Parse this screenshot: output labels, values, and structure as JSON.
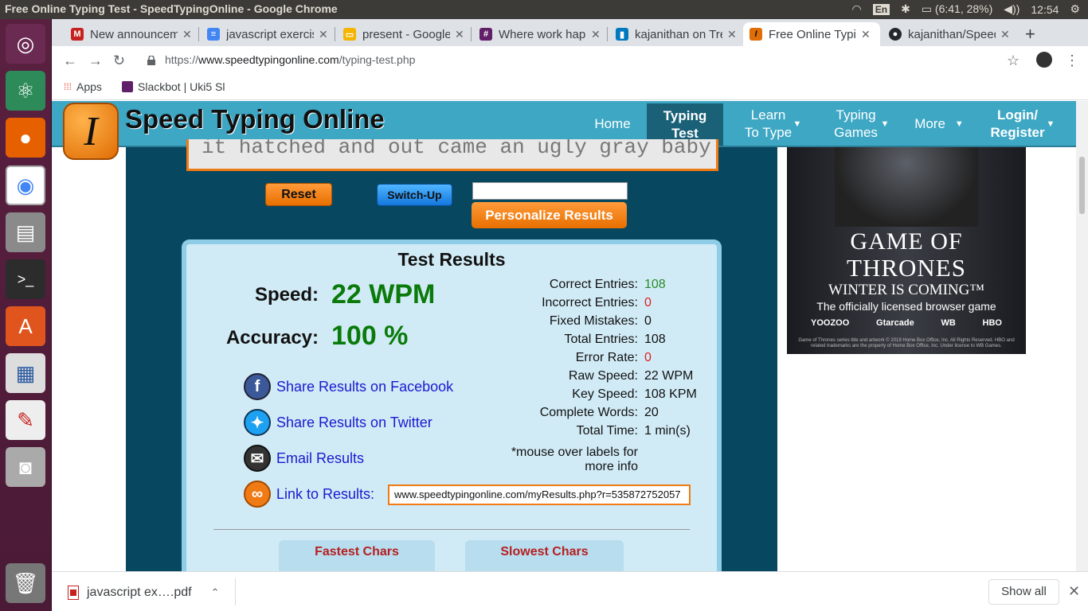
{
  "os": {
    "window_title": "Free Online Typing Test - SpeedTypingOnline - Google Chrome",
    "lang": "En",
    "battery": "(6:41, 28%)",
    "clock": "12:54"
  },
  "tabs": [
    {
      "label": "New announcement",
      "icon": "gmail-icon",
      "color": "#c5221f"
    },
    {
      "label": "javascript exercises",
      "icon": "docs-icon",
      "color": "#4285f4"
    },
    {
      "label": "present - Google Slides",
      "icon": "slides-icon",
      "color": "#f4b400"
    },
    {
      "label": "Where work happens",
      "icon": "slack-icon",
      "color": "#611f69"
    },
    {
      "label": "kajanithan on Trello",
      "icon": "trello-icon",
      "color": "#0079bf"
    },
    {
      "label": "Free Online Typing Test",
      "icon": "speedtyping-icon",
      "color": "#e06d05"
    },
    {
      "label": "kajanithan/SpeedTyping",
      "icon": "github-icon",
      "color": "#24292e"
    }
  ],
  "toolbar": {
    "url_prefix": "https://",
    "url_domain": "www.speedtypingonline.com",
    "url_path": "/typing-test.php"
  },
  "bookmarks": {
    "apps": "Apps",
    "slackbot": "Slackbot | Uki5 Sl"
  },
  "site": {
    "name": "Speed Typing Online",
    "logo_letter": "I",
    "nav": {
      "home": "Home",
      "typing_test": "Typing Test",
      "learn": "Learn To Type",
      "games": "Typing Games",
      "more": "More",
      "login": "Login/ Register"
    }
  },
  "test": {
    "passage_text": "it hatched and out came an ugly gray baby",
    "reset": "Reset",
    "switch_up": "Switch-Up",
    "personalize": "Personalize Results",
    "personalize_value": ""
  },
  "results": {
    "title": "Test Results",
    "speed_label": "Speed:",
    "speed_value": "22 WPM",
    "accuracy_label": "Accuracy:",
    "accuracy_value": "100 %",
    "stats": [
      {
        "label": "Correct Entries:",
        "value": "108",
        "color": "green"
      },
      {
        "label": "Incorrect Entries:",
        "value": "0",
        "color": "red"
      },
      {
        "label": "Fixed Mistakes:",
        "value": "0",
        "color": "black"
      },
      {
        "label": "Total Entries:",
        "value": "108",
        "color": "black"
      },
      {
        "label": "Error Rate:",
        "value": "0",
        "color": "red"
      },
      {
        "label": "Raw Speed:",
        "value": "22 WPM",
        "color": "black"
      },
      {
        "label": "Key Speed:",
        "value": "108 KPM",
        "color": "black"
      },
      {
        "label": "Complete Words:",
        "value": "20",
        "color": "black"
      },
      {
        "label": "Total Time:",
        "value": "1 min(s)",
        "color": "black"
      }
    ],
    "note": "*mouse over labels for more info",
    "share_facebook": "Share Results on Facebook",
    "share_twitter": "Share Results on Twitter",
    "email": "Email Results",
    "link_label": "Link to Results:",
    "link_value": "www.speedtypingonline.com/myResults.php?r=535872752057",
    "fastest": "Fastest Chars",
    "slowest": "Slowest Chars"
  },
  "ad": {
    "line1": "GAME OF",
    "line2": "THRONES",
    "line3": "WINTER IS COMING™",
    "line4": "The officially licensed browser game",
    "brands": [
      "YOOZOO",
      "Gtarcade",
      "WB",
      "HBO"
    ],
    "fine_print": "Game of Thrones series title and artwork © 2019 Home Box Office, Inc. All Rights Reserved. HBO and related trademarks are the property of Home Box Office, Inc. Under license to WB Games."
  },
  "downloads": {
    "file": "javascript ex….pdf",
    "show_all": "Show all"
  }
}
